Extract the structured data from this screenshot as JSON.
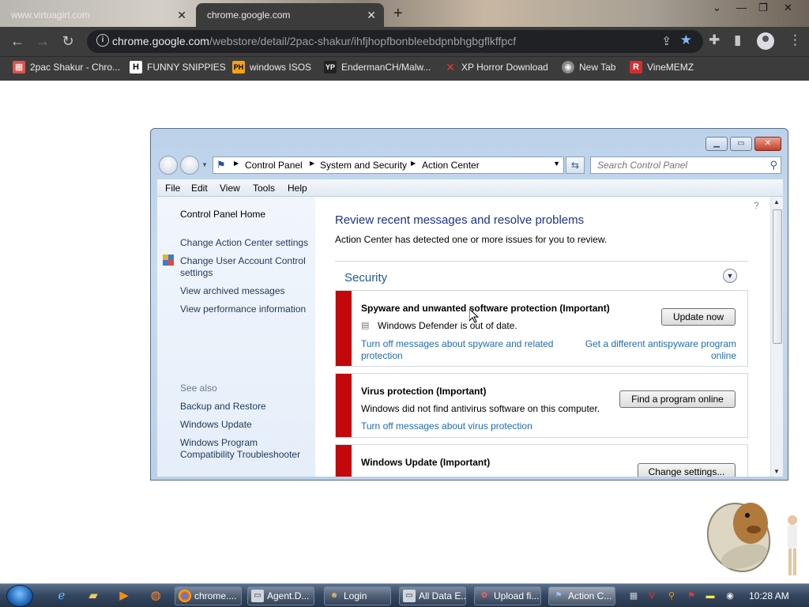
{
  "browser": {
    "tabs": [
      {
        "title": "www.virtuagirl.com"
      },
      {
        "title": "chrome.google.com"
      }
    ],
    "url_host": "chrome.google.com",
    "url_path": "/webstore/detail/2pac-shakur/ihfjhopfbonbleebdpnbhgbgflkffpcf",
    "bookmarks": [
      {
        "label": "2pac Shakur - Chro...",
        "icon": "bookmark-2pac-icon"
      },
      {
        "label": "FUNNY SNIPPIES",
        "icon": "bookmark-h-icon"
      },
      {
        "label": "windows ISOS",
        "icon": "bookmark-ph-icon"
      },
      {
        "label": "EndermanCH/Malw...",
        "icon": "bookmark-yp-icon"
      },
      {
        "label": "XP Horror Download",
        "icon": "bookmark-x-icon"
      },
      {
        "label": "New Tab",
        "icon": "bookmark-globe-icon"
      },
      {
        "label": "VineMEMZ",
        "icon": "bookmark-r-icon"
      }
    ]
  },
  "controlpanel": {
    "breadcrumb": [
      "Control Panel",
      "System and Security",
      "Action Center"
    ],
    "search_placeholder": "Search Control Panel",
    "menu": [
      "File",
      "Edit",
      "View",
      "Tools",
      "Help"
    ],
    "left": {
      "home": "Control Panel Home",
      "links": [
        "Change Action Center settings",
        "Change User Account Control settings",
        "View archived messages",
        "View performance information"
      ],
      "see_also": "See also",
      "see_also_links": [
        "Backup and Restore",
        "Windows Update",
        "Windows Program Compatibility Troubleshooter"
      ]
    },
    "main": {
      "heading": "Review recent messages and resolve problems",
      "subtext": "Action Center has detected one or more issues for you to review.",
      "section": "Security",
      "cards": [
        {
          "title": "Spyware and unwanted software protection  (Important)",
          "text": "Windows Defender is out of date.",
          "button": "Update now",
          "link1": "Turn off messages about spyware and related protection",
          "link2": "Get a different antispyware program online"
        },
        {
          "title": "Virus protection  (Important)",
          "text": "Windows did not find antivirus software on this computer.",
          "button": "Find a program online",
          "link1": "Turn off messages about virus protection"
        },
        {
          "title": "Windows Update  (Important)",
          "button": "Change settings..."
        }
      ]
    }
  },
  "taskbar": {
    "buttons": [
      "chrome....",
      "Agent.D...",
      "Login",
      "All Data E...",
      "Upload fi...",
      "Action C..."
    ],
    "clock": "10:28 AM"
  },
  "colors": {
    "chrome_dark": "#3c3c3c",
    "link_blue": "#1f6bb4",
    "heading_blue": "#1e3287",
    "alert_red": "#c2080a",
    "star_blue": "#8ab4f8"
  }
}
